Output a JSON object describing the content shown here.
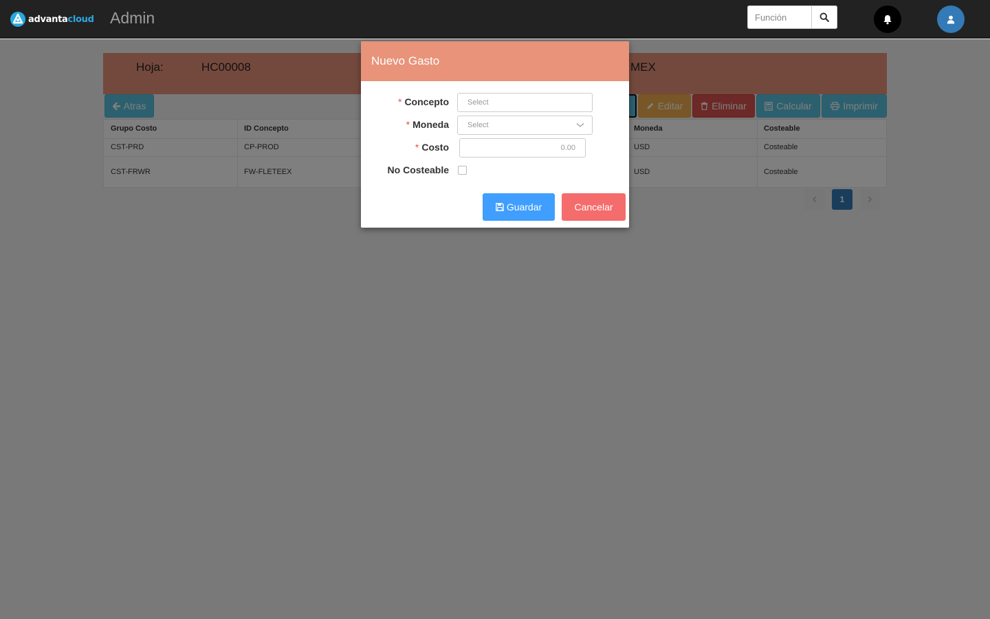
{
  "app": {
    "brand_part1": "advanta",
    "brand_part2": "cloud",
    "title": "Admin",
    "search_placeholder": "Función"
  },
  "sheet": {
    "label": "Hoja:",
    "id": "HC00008",
    "location_fragment": "MEX"
  },
  "toolbar": {
    "back": "Atras",
    "edit": "Editar",
    "delete": "Eliminar",
    "calculate": "Calcular",
    "print": "Imprimir"
  },
  "table": {
    "columns": [
      "Grupo Costo",
      "ID Concepto",
      "Moneda",
      "Costeable"
    ],
    "rows": [
      {
        "grupo": "CST-PRD",
        "concepto": "CP-PROD",
        "moneda": "USD",
        "costeable": "Costeable"
      },
      {
        "grupo": "CST-FRWR",
        "concepto": "FW-FLETEEX",
        "moneda": "USD",
        "costeable": "Costeable"
      }
    ]
  },
  "pagination": {
    "current": "1"
  },
  "modal": {
    "title": "Nuevo Gasto",
    "required_mark": "*",
    "concepto_label": "Concepto",
    "concepto_placeholder": "Select",
    "moneda_label": "Moneda",
    "moneda_placeholder": "Select",
    "costo_label": "Costo",
    "costo_placeholder": "0.00",
    "no_costeable_label": "No Costeable",
    "save": "Guardar",
    "cancel": "Cancelar"
  },
  "colors": {
    "header_accent": "#e8937a",
    "save_button": "#409eff",
    "cancel_button": "#f56c6c"
  }
}
